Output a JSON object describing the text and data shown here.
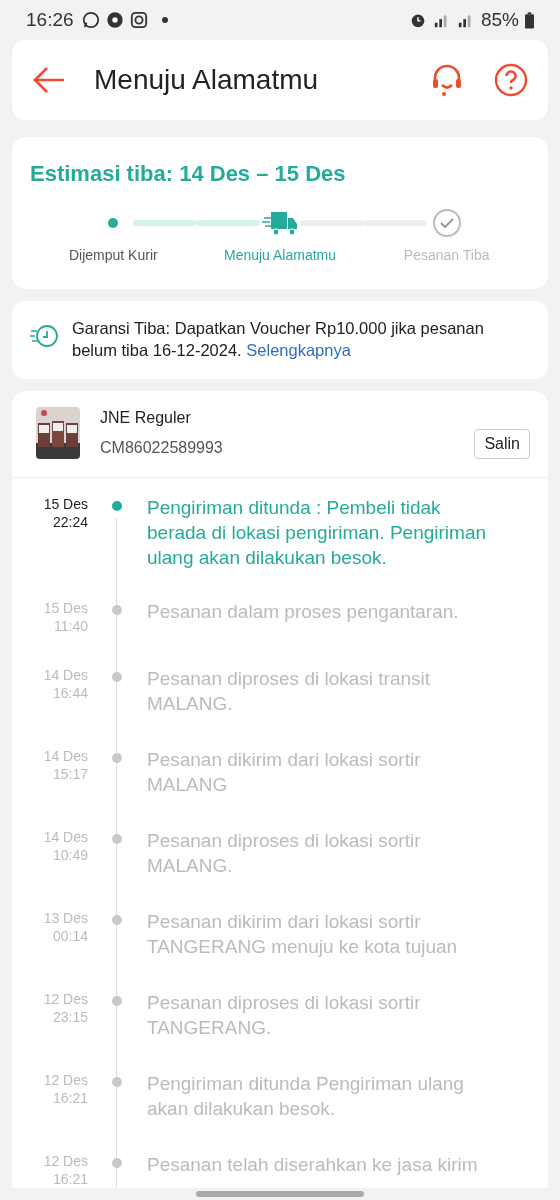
{
  "status_bar": {
    "time": "16:26",
    "battery": "85%"
  },
  "header": {
    "title": "Menuju Alamatmu"
  },
  "estimate": {
    "title": "Estimasi tiba: 14 Des – 15 Des",
    "steps": [
      {
        "label": "Dijemput Kurir",
        "selected": false
      },
      {
        "label": "Menuju Alamatmu",
        "selected": true
      },
      {
        "label": "Pesanan Tiba",
        "selected": false
      }
    ]
  },
  "guarantee": {
    "text": "Garansi Tiba: Dapatkan Voucher Rp10.000 jika pesanan belum tiba 16-12-2024.",
    "link": "Selengkapnya"
  },
  "shipment": {
    "courier": "JNE Reguler",
    "tracking_number": "CM86022589993",
    "copy_button": "Salin"
  },
  "timeline": [
    {
      "date": "15 Des",
      "time": "22:24",
      "text": "Pengiriman ditunda : Pembeli tidak berada di lokasi pengiriman. Pengiriman ulang akan dilakukan besok.",
      "active": true
    },
    {
      "date": "15 Des",
      "time": "11:40",
      "text": "Pesanan dalam proses pengantaran.",
      "active": false
    },
    {
      "date": "14 Des",
      "time": "16:44",
      "text": "Pesanan diproses di lokasi transit MALANG.",
      "active": false
    },
    {
      "date": "14 Des",
      "time": "15:17",
      "text": "Pesanan dikirim dari lokasi sortir MALANG",
      "active": false
    },
    {
      "date": "14 Des",
      "time": "10:49",
      "text": "Pesanan diproses di lokasi sortir MALANG.",
      "active": false
    },
    {
      "date": "13 Des",
      "time": "00:14",
      "text": "Pesanan dikirim dari lokasi sortir TANGERANG menuju ke kota tujuan",
      "active": false
    },
    {
      "date": "12 Des",
      "time": "23:15",
      "text": "Pesanan diproses di lokasi sortir TANGERANG.",
      "active": false
    },
    {
      "date": "12 Des",
      "time": "16:21",
      "text": "Pengiriman ditunda  Pengiriman ulang akan dilakukan besok.",
      "active": false
    },
    {
      "date": "12 Des",
      "time": "16:21",
      "text": "Pesanan telah diserahkan ke jasa kirim",
      "active": false
    }
  ]
}
